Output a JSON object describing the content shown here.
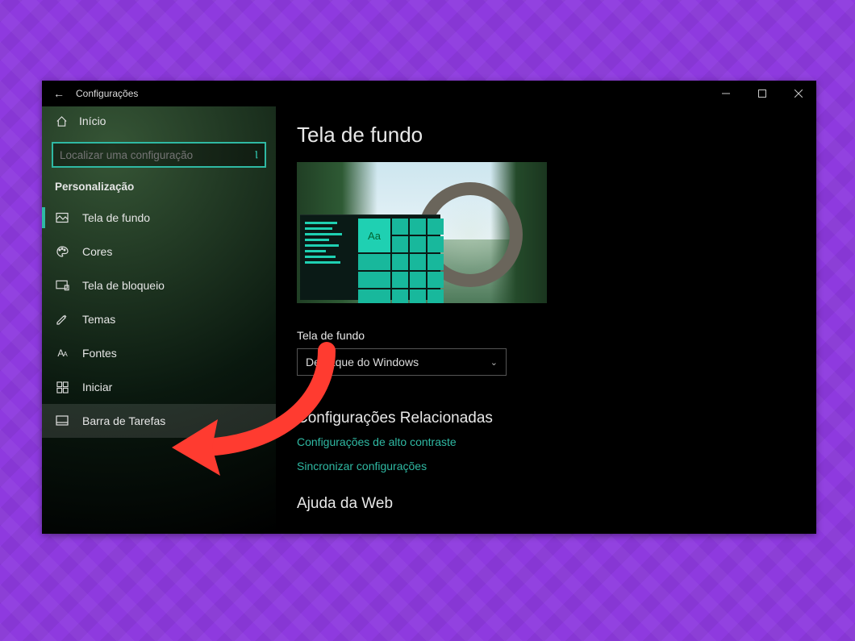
{
  "window": {
    "title": "Configurações"
  },
  "sidebar": {
    "home": "Início",
    "search_placeholder": "Localizar uma configuração",
    "section": "Personalização",
    "items": [
      {
        "label": "Tela de fundo"
      },
      {
        "label": "Cores"
      },
      {
        "label": "Tela de bloqueio"
      },
      {
        "label": "Temas"
      },
      {
        "label": "Fontes"
      },
      {
        "label": "Iniciar"
      },
      {
        "label": "Barra de Tarefas"
      }
    ]
  },
  "content": {
    "heading": "Tela de fundo",
    "preview_tile_text": "Aa",
    "field_label": "Tela de fundo",
    "dropdown_value": "Destaque do Windows",
    "related_heading": "Configurações Relacionadas",
    "links": [
      "Configurações de alto contraste",
      "Sincronizar configurações"
    ],
    "web_help_heading": "Ajuda da Web"
  }
}
